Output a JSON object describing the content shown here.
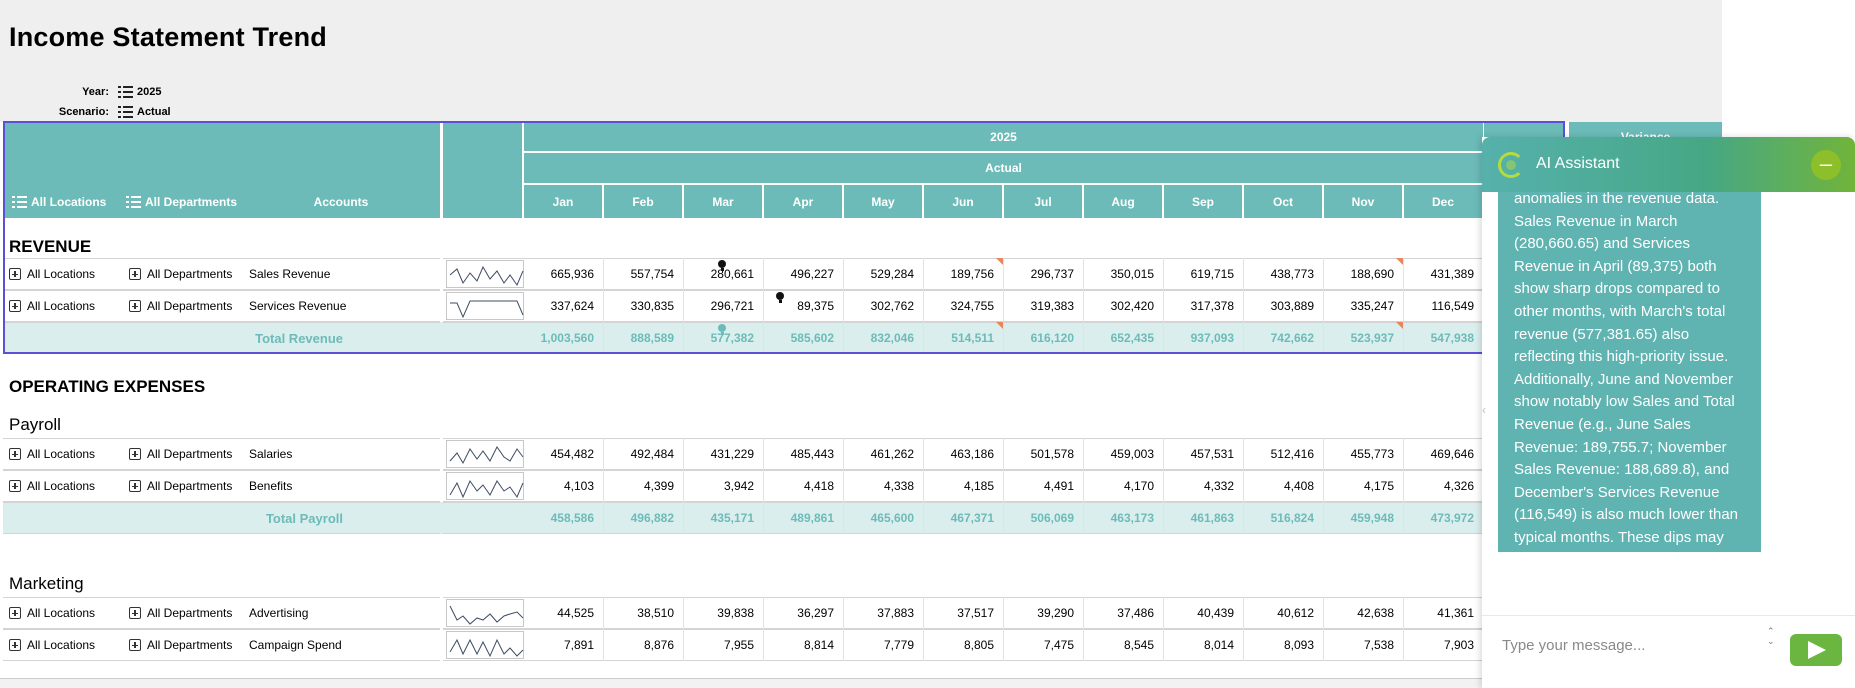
{
  "title": "Income Statement Trend",
  "filters": {
    "year_label": "Year:",
    "year_value": "2025",
    "scenario_label": "Scenario:",
    "scenario_value": "Actual"
  },
  "header": {
    "year": "2025",
    "scenario": "Actual",
    "variance": "Variance",
    "locations": "All Locations",
    "departments": "All Departments",
    "accounts": "Accounts",
    "months": [
      "Jan",
      "Feb",
      "Mar",
      "Apr",
      "May",
      "Jun",
      "Jul",
      "Aug",
      "Sep",
      "Oct",
      "Nov",
      "Dec"
    ]
  },
  "sections": {
    "revenue": "REVENUE",
    "opex": "OPERATING EXPENSES",
    "payroll": "Payroll",
    "marketing": "Marketing"
  },
  "rows": [
    {
      "loc": "All Locations",
      "dept": "All Departments",
      "account": "Sales Revenue",
      "values": [
        "665,936",
        "557,754",
        "280,661",
        "496,227",
        "529,284",
        "189,756",
        "296,737",
        "350,015",
        "619,715",
        "438,773",
        "188,690",
        "431,389"
      ]
    },
    {
      "loc": "All Locations",
      "dept": "All Departments",
      "account": "Services Revenue",
      "values": [
        "337,624",
        "330,835",
        "296,721",
        "89,375",
        "302,762",
        "324,755",
        "319,383",
        "302,420",
        "317,378",
        "303,889",
        "335,247",
        "116,549"
      ]
    },
    {
      "label": "Total Revenue",
      "values": [
        "1,003,560",
        "888,589",
        "577,382",
        "585,602",
        "832,046",
        "514,511",
        "616,120",
        "652,435",
        "937,093",
        "742,662",
        "523,937",
        "547,938"
      ]
    },
    {
      "loc": "All Locations",
      "dept": "All Departments",
      "account": "Salaries",
      "values": [
        "454,482",
        "492,484",
        "431,229",
        "485,443",
        "461,262",
        "463,186",
        "501,578",
        "459,003",
        "457,531",
        "512,416",
        "455,773",
        "469,646"
      ]
    },
    {
      "loc": "All Locations",
      "dept": "All Departments",
      "account": "Benefits",
      "values": [
        "4,103",
        "4,399",
        "3,942",
        "4,418",
        "4,338",
        "4,185",
        "4,491",
        "4,170",
        "4,332",
        "4,408",
        "4,175",
        "4,326"
      ]
    },
    {
      "label": "Total Payroll",
      "values": [
        "458,586",
        "496,882",
        "435,171",
        "489,861",
        "465,600",
        "467,371",
        "506,069",
        "463,173",
        "461,863",
        "516,824",
        "459,948",
        "473,972"
      ]
    },
    {
      "loc": "All Locations",
      "dept": "All Departments",
      "account": "Advertising",
      "values": [
        "44,525",
        "38,510",
        "39,838",
        "36,297",
        "37,883",
        "37,517",
        "39,290",
        "37,486",
        "40,439",
        "40,612",
        "42,638",
        "41,361"
      ]
    },
    {
      "loc": "All Locations",
      "dept": "All Departments",
      "account": "Campaign Spend",
      "values": [
        "7,891",
        "8,876",
        "7,955",
        "8,814",
        "7,779",
        "8,805",
        "7,475",
        "8,545",
        "8,014",
        "8,093",
        "7,538",
        "7,903"
      ]
    }
  ],
  "ai": {
    "title": "AI Assistant",
    "message": "anomalies in the revenue data. Sales Revenue in March (280,660.65) and Services Revenue in April (89,375) both show sharp drops compared to other months, with March's total revenue (577,381.65) also reflecting this high-priority issue. Additionally, June and November show notably low Sales and Total Revenue (e.g., June Sales Revenue: 189,755.7; November Sales Revenue: 188,689.8), and December's Services Revenue (116,549) is also much lower than typical months. These dips may indicate data entry errors, seasonality, or underlying business issues that require immediate attention.",
    "input_placeholder": "Type your message..."
  }
}
